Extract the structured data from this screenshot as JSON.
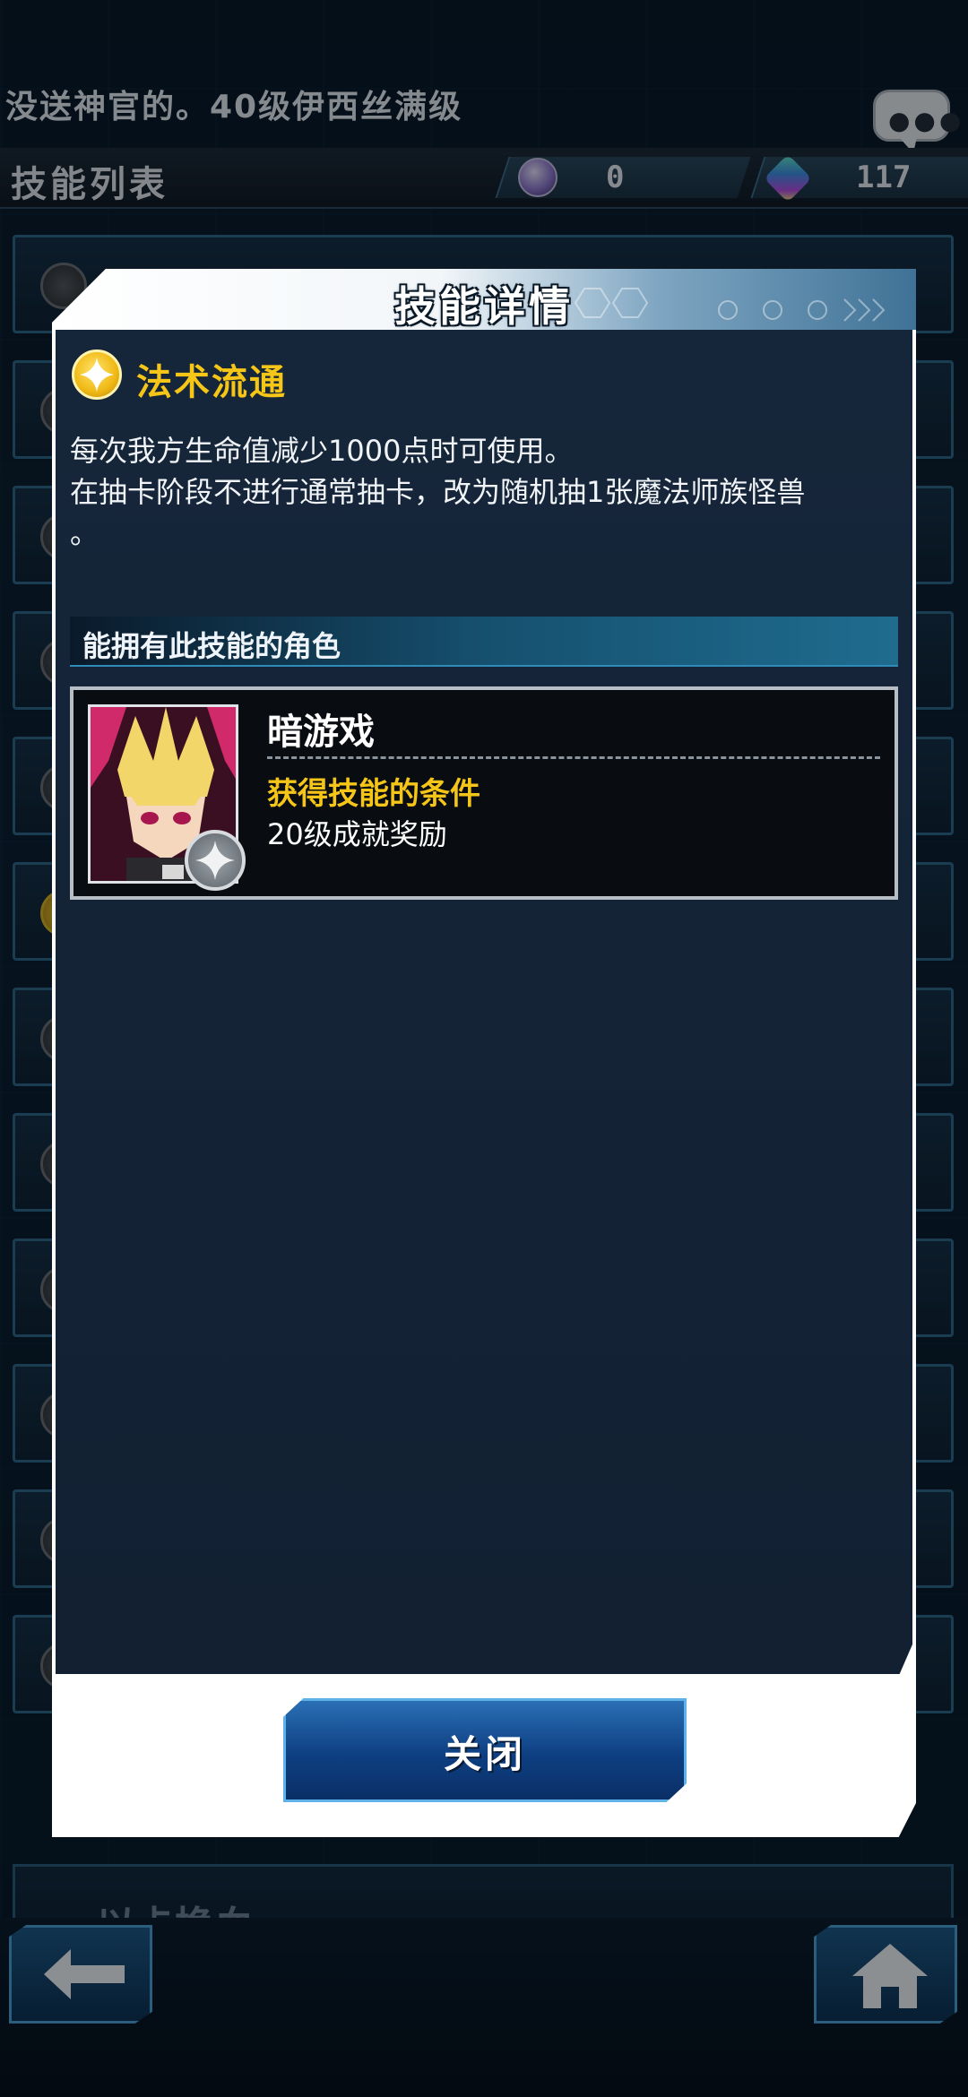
{
  "header": {
    "banner_text": "没送神官的。40级伊西丝满级",
    "page_title": "技能列表",
    "currency_orb_value": "0",
    "currency_gem_value": "117"
  },
  "background": {
    "partial_item_label": "以卡换血"
  },
  "modal": {
    "title": "技能详情",
    "skill": {
      "name": "法术流通",
      "description_line1": "每次我方生命值减少1000点时可使用。",
      "description_line2": "在抽卡阶段不进行通常抽卡，改为随机抽1张魔法师族怪兽",
      "description_line3": "。"
    },
    "section_label": "能拥有此技能的角色",
    "character": {
      "name": "暗游戏",
      "condition_label": "获得技能的条件",
      "condition_value": "20级成就奖励"
    },
    "close_label": "关闭"
  },
  "icons": {
    "skill": "star-icon",
    "badge": "gray-star-badge-icon",
    "chat": "chat-bubble-icon",
    "back": "back-arrow-icon",
    "home": "home-icon",
    "currency_orb": "orb-icon",
    "currency_gem": "gem-icon"
  },
  "colors": {
    "accent_gold": "#f5c518",
    "panel_dark": "#16263a",
    "button_blue": "#0e3f82"
  }
}
